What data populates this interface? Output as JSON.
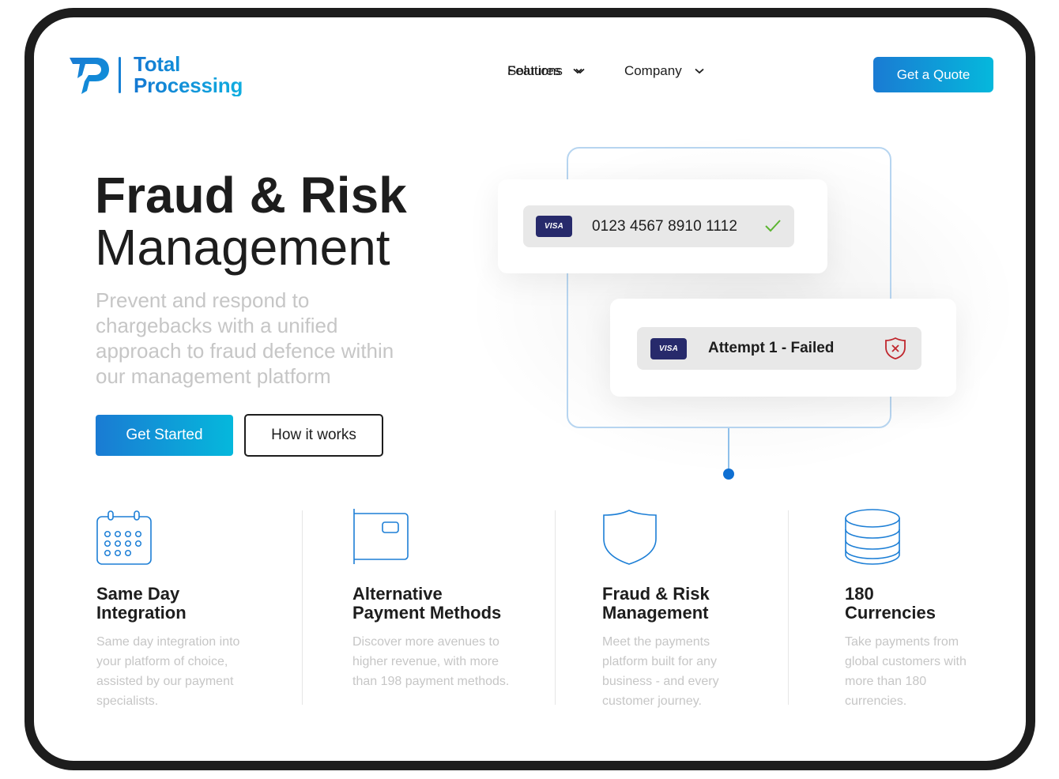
{
  "brand": {
    "name_line1": "Total",
    "name_line2": "Processing",
    "colors": {
      "primary": "#1a7bd3",
      "accent": "#05b8dc",
      "dark": "#1d1d1d",
      "muted": "#c6c6c6",
      "visa": "#272a6b",
      "success": "#5cb531",
      "danger": "#c0262d"
    }
  },
  "nav": {
    "items": [
      {
        "label": "Solutions",
        "icon": "chevron-down-icon"
      },
      {
        "label": "Company",
        "icon": "chevron-down-icon"
      },
      {
        "label": "Features",
        "icon": "chevron-down-icon"
      }
    ],
    "cta_label": "Get a Quote"
  },
  "hero": {
    "title_line1": "Fraud & Risk",
    "title_line2": "Management",
    "subtitle": "Prevent and respond to chargebacks with a unified approach to fraud defence within our management platform",
    "primary_cta": "Get Started",
    "secondary_cta": "How it works"
  },
  "illustration": {
    "card_1": {
      "brand": "VISA",
      "number": "0123 4567 8910 1112",
      "status_icon": "check-icon"
    },
    "card_2": {
      "brand": "VISA",
      "text": "Attempt 1 - Failed",
      "status_icon": "shield-x-icon"
    }
  },
  "features": [
    {
      "icon": "calendar-icon",
      "title_line1": "Same Day",
      "title_line2": "Integration",
      "description": "Same day integration into your platform of choice, assisted by our payment specialists."
    },
    {
      "icon": "wallet-icon",
      "title_line1": "Alternative",
      "title_line2": "Payment Methods",
      "description": "Discover more avenues to higher revenue, with more than 198 payment methods."
    },
    {
      "icon": "shield-icon",
      "title_line1": "Fraud & Risk",
      "title_line2": "Management",
      "description": "Meet the payments platform built for any business - and every customer journey."
    },
    {
      "icon": "coins-stack-icon",
      "title_line1": "180",
      "title_line2": "Currencies",
      "description": "Take payments from global customers with more than 180 currencies."
    }
  ]
}
